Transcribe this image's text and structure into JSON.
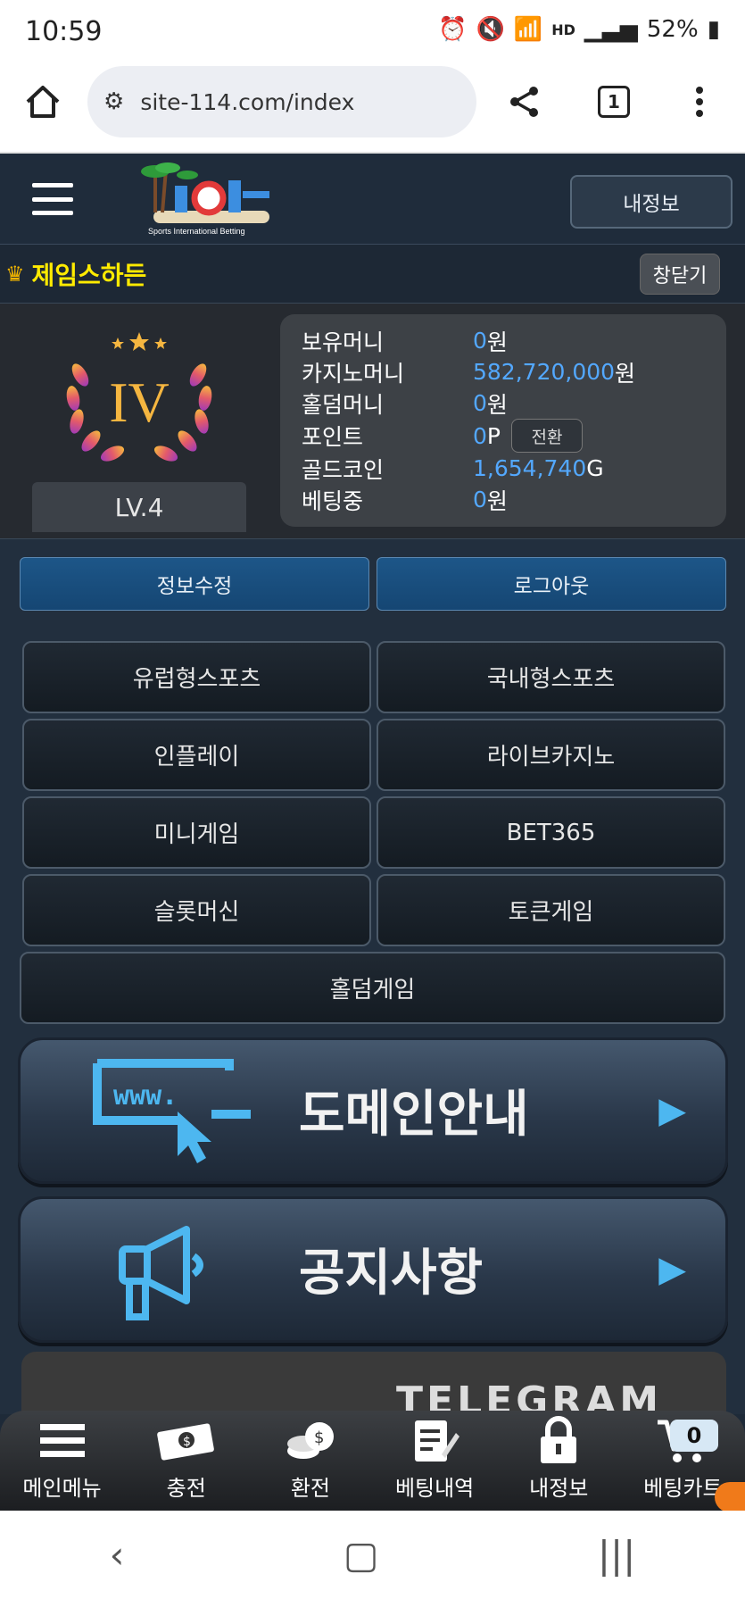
{
  "status_bar": {
    "time": "10:59",
    "battery": "52%",
    "hd_label": "HD"
  },
  "browser": {
    "url": "site-114.com/index",
    "tab_count": "1"
  },
  "header": {
    "myinfo_label": "내정보",
    "logo_text": "Sports International Betting"
  },
  "user": {
    "name": "제임스하든",
    "close_label": "창닫기",
    "level_roman": "IV",
    "level_label": "LV.4"
  },
  "money": [
    {
      "label": "보유머니",
      "value": "0",
      "unit": "원"
    },
    {
      "label": "카지노머니",
      "value": "582,720,000",
      "unit": "원"
    },
    {
      "label": "홀덤머니",
      "value": "0",
      "unit": "원"
    },
    {
      "label": "포인트",
      "value": "0",
      "unit": "P",
      "button": "전환"
    },
    {
      "label": "골드코인",
      "value": "1,654,740",
      "unit": "G"
    },
    {
      "label": "베팅중",
      "value": "0",
      "unit": "원"
    }
  ],
  "actions": {
    "edit": "정보수정",
    "logout": "로그아웃"
  },
  "games": [
    "유럽형스포츠",
    "국내형스포츠",
    "인플레이",
    "라이브카지노",
    "미니게임",
    "BET365",
    "슬롯머신",
    "토큰게임",
    "홀덤게임"
  ],
  "banners": {
    "domain": "도메인안내",
    "notice": "공지사항",
    "www_text": "www.",
    "telegram": "TELEGRAM"
  },
  "bottom_nav": [
    "메인메뉴",
    "충전",
    "환전",
    "베팅내역",
    "내정보",
    "베팅카트"
  ],
  "cart_count": "0",
  "colors": {
    "accent_blue": "#53a8ff",
    "name_yellow": "#ffeb00",
    "arrow_blue": "#4db7f0"
  }
}
